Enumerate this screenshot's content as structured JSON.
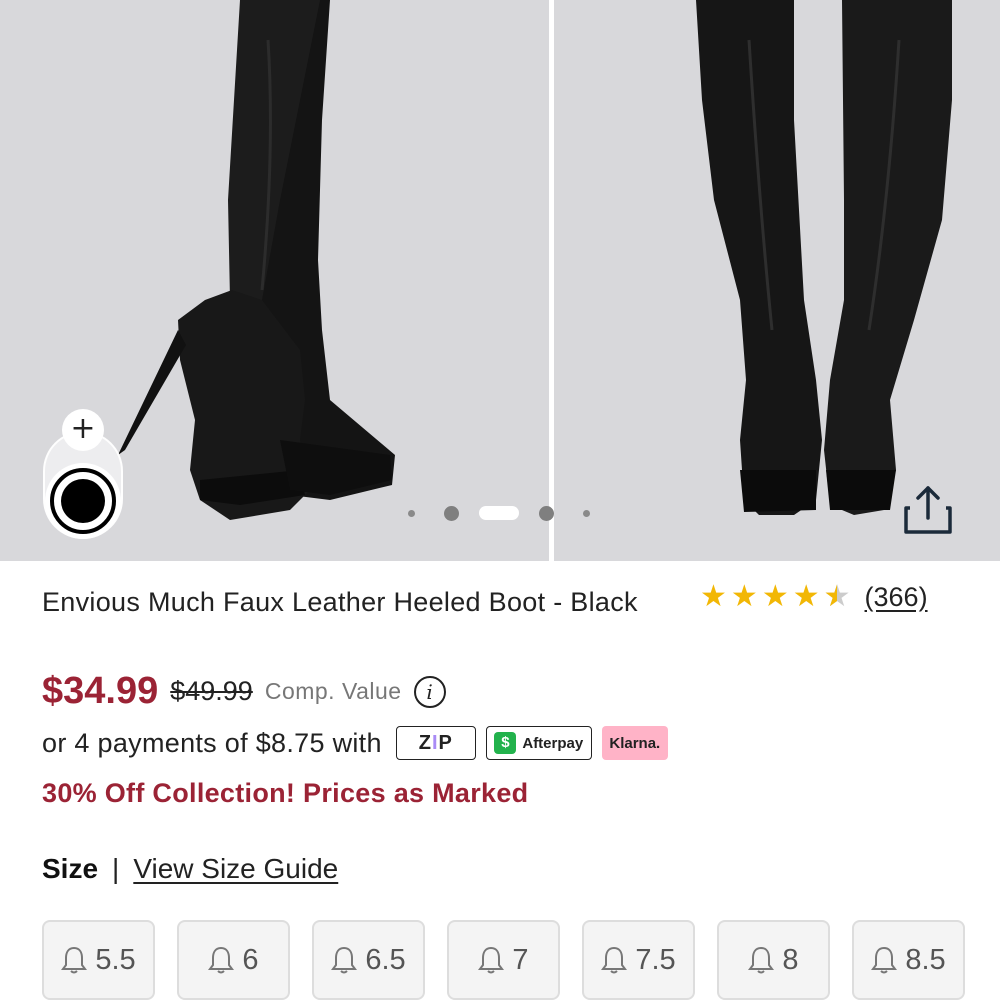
{
  "gallery": {
    "pager": {
      "total": 5,
      "active_index": 2
    }
  },
  "product": {
    "title": "Envious Much Faux Leather Heeled Boot - Black",
    "rating": 4.5,
    "review_count": "(366)",
    "price": "$34.99",
    "original_price": "$49.99",
    "comp_label": "Comp. Value",
    "installments_text": "or 4 payments of $8.75 with",
    "payment_providers": [
      "zip",
      "Afterpay",
      "Klarna."
    ],
    "promo": "30% Off Collection! Prices as Marked"
  },
  "size": {
    "label": "Size",
    "separator": "|",
    "guide_link": "View Size Guide",
    "options": [
      "5.5",
      "6",
      "6.5",
      "7",
      "7.5",
      "8",
      "8.5"
    ]
  },
  "colors": {
    "price_red": "#9b2335",
    "star_gold": "#f2b705",
    "afterpay_green": "#22b24c",
    "klarna_pink": "#ffb3c7"
  }
}
